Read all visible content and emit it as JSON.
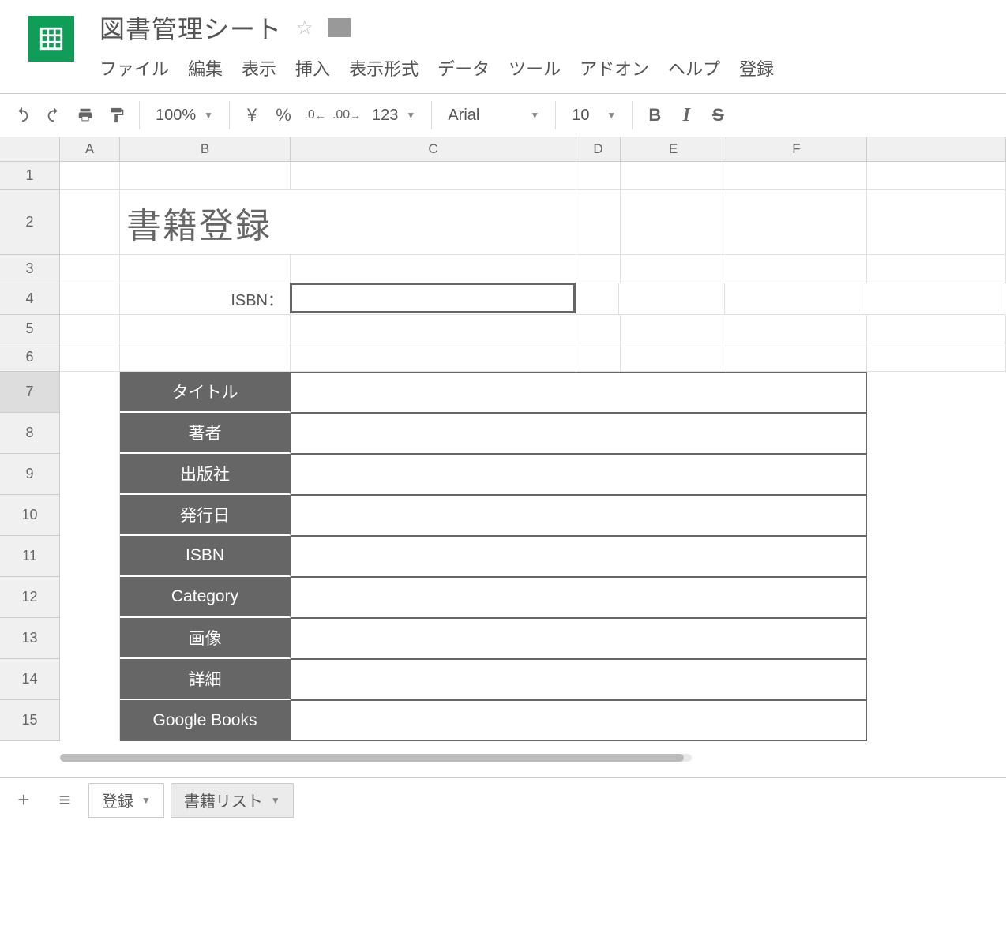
{
  "header": {
    "doc_title": "図書管理シート"
  },
  "menu": {
    "items": [
      "ファイル",
      "編集",
      "表示",
      "挿入",
      "表示形式",
      "データ",
      "ツール",
      "アドオン",
      "ヘルプ",
      "登録"
    ]
  },
  "toolbar": {
    "zoom": "100%",
    "currency": "¥",
    "percent": "%",
    "dec_dec": ".0",
    "inc_dec": ".00",
    "format_123": "123",
    "font": "Arial",
    "size": "10",
    "bold": "B",
    "italic": "I",
    "strike": "S"
  },
  "columns": [
    "A",
    "B",
    "C",
    "D",
    "E",
    "F"
  ],
  "rows": [
    "1",
    "2",
    "3",
    "4",
    "5",
    "6",
    "7",
    "8",
    "9",
    "10",
    "11",
    "12",
    "13",
    "14",
    "15"
  ],
  "sheet": {
    "title": "書籍登録",
    "isbn_label": "ISBN：",
    "isbn_value": "",
    "fields": [
      {
        "label": "タイトル",
        "value": ""
      },
      {
        "label": "著者",
        "value": ""
      },
      {
        "label": "出版社",
        "value": ""
      },
      {
        "label": "発行日",
        "value": ""
      },
      {
        "label": "ISBN",
        "value": ""
      },
      {
        "label": "Category",
        "value": ""
      },
      {
        "label": "画像",
        "value": ""
      },
      {
        "label": "詳細",
        "value": ""
      },
      {
        "label": "Google Books",
        "value": ""
      }
    ]
  },
  "tabs": {
    "active": "登録",
    "inactive": "書籍リスト"
  }
}
